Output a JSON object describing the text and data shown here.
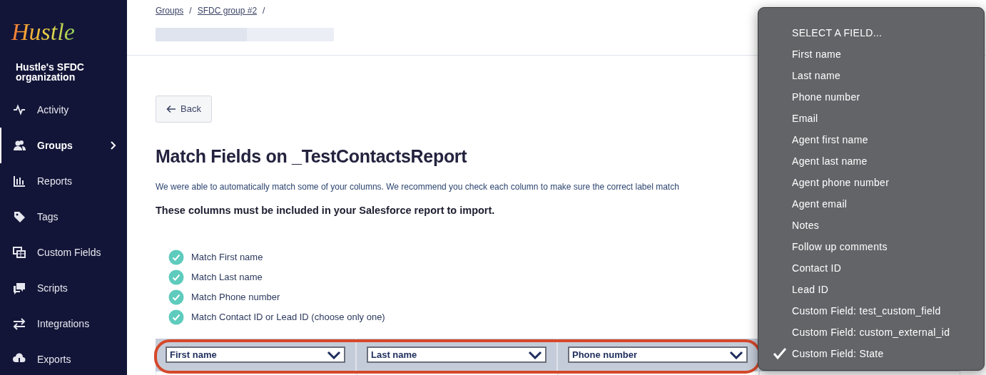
{
  "sidebar": {
    "logo": "Hustle",
    "org_name": "Hustle's SFDC organization",
    "items": [
      {
        "label": "Activity",
        "selected": false
      },
      {
        "label": "Groups",
        "selected": true
      },
      {
        "label": "Reports",
        "selected": false
      },
      {
        "label": "Tags",
        "selected": false
      },
      {
        "label": "Custom Fields",
        "selected": false
      },
      {
        "label": "Scripts",
        "selected": false
      },
      {
        "label": "Integrations",
        "selected": false
      },
      {
        "label": "Exports",
        "selected": false
      }
    ]
  },
  "breadcrumb": [
    {
      "label": "Groups",
      "separator": "/"
    },
    {
      "label": "SFDC group #2",
      "separator": "/"
    }
  ],
  "back_button": "Back",
  "title": "Match Fields on _TestContactsReport",
  "description": "We were able to automatically match some of your columns. We recommend you check each column to make sure the correct label match",
  "requirement": "These columns must be included in your Salesforce report to import.",
  "checklist": [
    {
      "label": "Match First name",
      "checked": true
    },
    {
      "label": "Match Last name",
      "checked": true
    },
    {
      "label": "Match Phone number",
      "checked": true
    },
    {
      "label": "Match Contact ID or Lead ID (choose only one)",
      "checked": true
    }
  ],
  "table": {
    "columns": [
      {
        "value": "First name"
      },
      {
        "value": "Last name"
      },
      {
        "value": "Phone number"
      }
    ]
  },
  "dropdown": {
    "options": [
      {
        "label": "SELECT A FIELD...",
        "selected": false
      },
      {
        "label": "First name",
        "selected": false
      },
      {
        "label": "Last name",
        "selected": false
      },
      {
        "label": "Phone number",
        "selected": false
      },
      {
        "label": "Email",
        "selected": false
      },
      {
        "label": "Agent first name",
        "selected": false
      },
      {
        "label": "Agent last name",
        "selected": false
      },
      {
        "label": "Agent phone number",
        "selected": false
      },
      {
        "label": "Agent email",
        "selected": false
      },
      {
        "label": "Notes",
        "selected": false
      },
      {
        "label": "Follow up comments",
        "selected": false
      },
      {
        "label": "Contact ID",
        "selected": false
      },
      {
        "label": "Lead ID",
        "selected": false
      },
      {
        "label": "Custom Field: test_custom_field",
        "selected": false
      },
      {
        "label": "Custom Field: custom_external_id",
        "selected": false
      },
      {
        "label": "Custom Field: State",
        "selected": true
      }
    ]
  }
}
